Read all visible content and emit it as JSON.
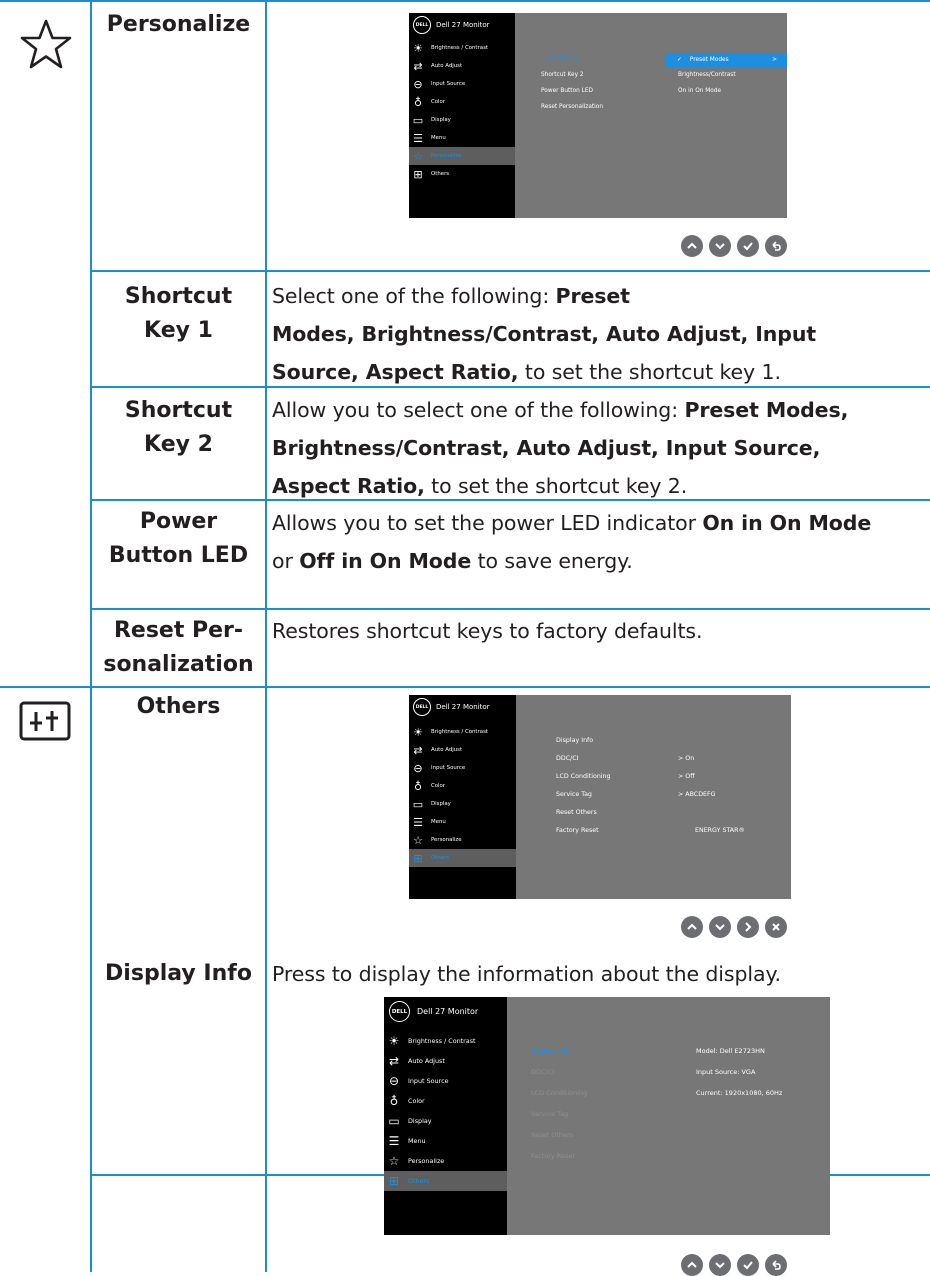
{
  "rows": {
    "personalize": {
      "title": "Personalize"
    },
    "shortcut1": {
      "title_l1": "Shortcut",
      "title_l2": "Key 1",
      "t1": "Select one of the following: ",
      "b1": "Preset",
      "b2": "Modes, Brightness/Contrast, Auto Adjust, Input",
      "b3": "Source, Aspect Ratio,",
      "t2": " to set the shortcut key 1."
    },
    "shortcut2": {
      "title_l1": "Shortcut",
      "title_l2": "Key 2",
      "t1": "Allow you to select one of the following: ",
      "b1": "Preset Modes,",
      "b2": "Brightness/Contrast, Auto Adjust, Input Source,",
      "b3": "Aspect Ratio,",
      "t2": " to set the shortcut key 2."
    },
    "powerled": {
      "title_l1": "Power",
      "title_l2": "Button LED",
      "t1": "Allows you to set the power LED indicator ",
      "b1": "On in On Mode",
      "t2": "or ",
      "b2": "Off in On Mode",
      "t3": " to save energy."
    },
    "reset": {
      "title_l1": "Reset Per-",
      "title_l2": "sonalization",
      "text": "Restores shortcut keys to factory defaults."
    },
    "others": {
      "title": "Others"
    },
    "displayinfo": {
      "title": "Display Info",
      "text": "Press to display the information about the display."
    }
  },
  "osd_common": {
    "monitor_name": "Dell 27 Monitor",
    "logo": "DELL",
    "menu": [
      "Brightness / Contrast",
      "Auto Adjust",
      "Input Source",
      "Color",
      "Display",
      "Menu",
      "Personalize",
      "Others"
    ],
    "menu_icons": [
      "brightness-icon",
      "auto-adjust-icon",
      "input-source-icon",
      "color-icon",
      "display-icon",
      "menu-icon",
      "personalize-star-icon",
      "others-icon"
    ]
  },
  "osd1": {
    "selected": "Personalize",
    "sub": [
      "Shortcut Key 1",
      "Shortcut Key 2",
      "Power Button LED",
      "Reset Personalization"
    ],
    "vals": [
      "Preset Modes",
      "Brightness/Contrast",
      "On in On Mode"
    ],
    "check": "✓",
    "arrow": ">"
  },
  "osd2": {
    "selected": "Others",
    "sub": [
      "Display Info",
      "DDC/CI",
      "LCD Conditioning",
      "Service Tag",
      "Reset Others",
      "Factory Reset"
    ],
    "vals": [
      "> On",
      "> Off",
      "> ABCDEFG",
      "ENERGY STAR®"
    ]
  },
  "osd3": {
    "selected": "Others",
    "sub": [
      "Display Info",
      "DDC/CI",
      "LCD Conditioning",
      "Service Tag",
      "Reset Others",
      "Factory Reset"
    ],
    "vals": [
      "Model: Dell E2723HN",
      "Input Source: VGA",
      "Current: 1920x1080, 60Hz"
    ]
  },
  "buttons": {
    "set1": [
      "up",
      "down",
      "check",
      "back"
    ],
    "set2": [
      "up",
      "down",
      "right",
      "close"
    ],
    "set3": [
      "up",
      "down",
      "check",
      "back"
    ]
  }
}
